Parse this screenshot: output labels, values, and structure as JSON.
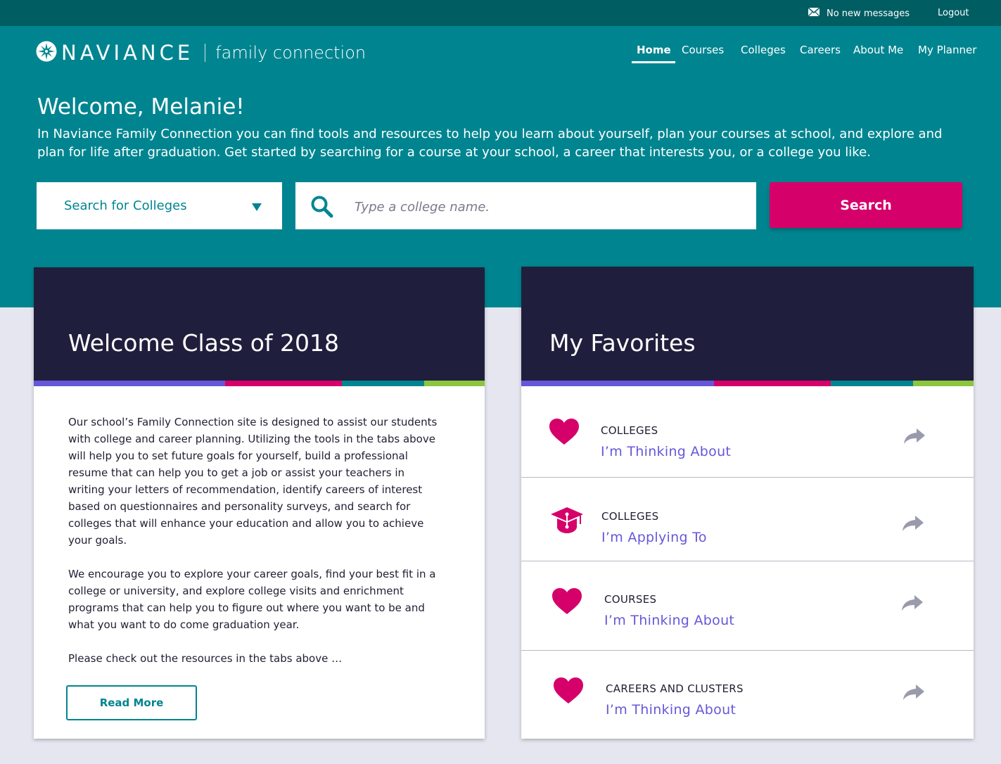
{
  "topbar": {
    "messages": "No new messages",
    "logout": "Logout",
    "icons": {
      "messages": "envelope-icon"
    }
  },
  "brand": {
    "name": "NAVIANCE",
    "product": "family connection",
    "icon": "compass-logo-icon"
  },
  "nav": {
    "items": [
      {
        "label": "Home",
        "active": true
      },
      {
        "label": "Courses",
        "active": false
      },
      {
        "label": "Colleges",
        "active": false
      },
      {
        "label": "Careers",
        "active": false
      },
      {
        "label": "About Me",
        "active": false
      },
      {
        "label": "My Planner",
        "active": false
      }
    ]
  },
  "hero": {
    "title": "Welcome, Melanie!",
    "intro": "In Naviance Family Connection you can find tools and resources to help you learn about yourself, plan your courses at school, and explore and plan for life after graduation. Get started by searching for a course at your school, a career that interests you, or a college you like."
  },
  "search": {
    "scope": "Search for Colleges",
    "placeholder": "Type a college name.",
    "button": "Search",
    "icons": {
      "search": "magnifier-icon",
      "scope": "caret-down-icon"
    }
  },
  "welcome_card": {
    "title": "Welcome Class of 2018",
    "paragraphs": [
      "Our school’s Family Connection site is designed to assist our students with college and career planning. Utilizing the tools in the tabs above will help you to set future goals for yourself, build a professional resume that can help you to get a job or assist your teachers in writing your letters of recommendation, identify careers of interest based on questionnaires and personality surveys, and search for colleges that will enhance your education and allow you to achieve your goals.",
      "We encourage you to explore your career goals, find your best fit in a college or university, and explore college visits and enrichment programs that can help you to figure out where you want to be and what you want to do come graduation year.",
      "Please check out the resources in the tabs above  …"
    ],
    "read_more": "Read More"
  },
  "favorites_card": {
    "title": "My Favorites",
    "items": [
      {
        "category": "COLLEGES",
        "link": "I’m Thinking About",
        "icon": "heart-icon"
      },
      {
        "category": "COLLEGES",
        "link": "I’m Applying To",
        "icon": "graduation-cap-icon"
      },
      {
        "category": "COURSES",
        "link": "I’m Thinking About",
        "icon": "heart-icon"
      },
      {
        "category": "CAREERS AND CLUSTERS",
        "link": "I’m Thinking About",
        "icon": "heart-icon"
      }
    ],
    "share_icon": "share-arrow-icon"
  },
  "colors": {
    "topbar": "#005e63",
    "hero": "#008590",
    "accent": "#d6006a",
    "card_header": "#1f1f3d",
    "link": "#6657d9",
    "stripe": [
      "#6657d9",
      "#d6006a",
      "#008590",
      "#8cc63f"
    ]
  }
}
